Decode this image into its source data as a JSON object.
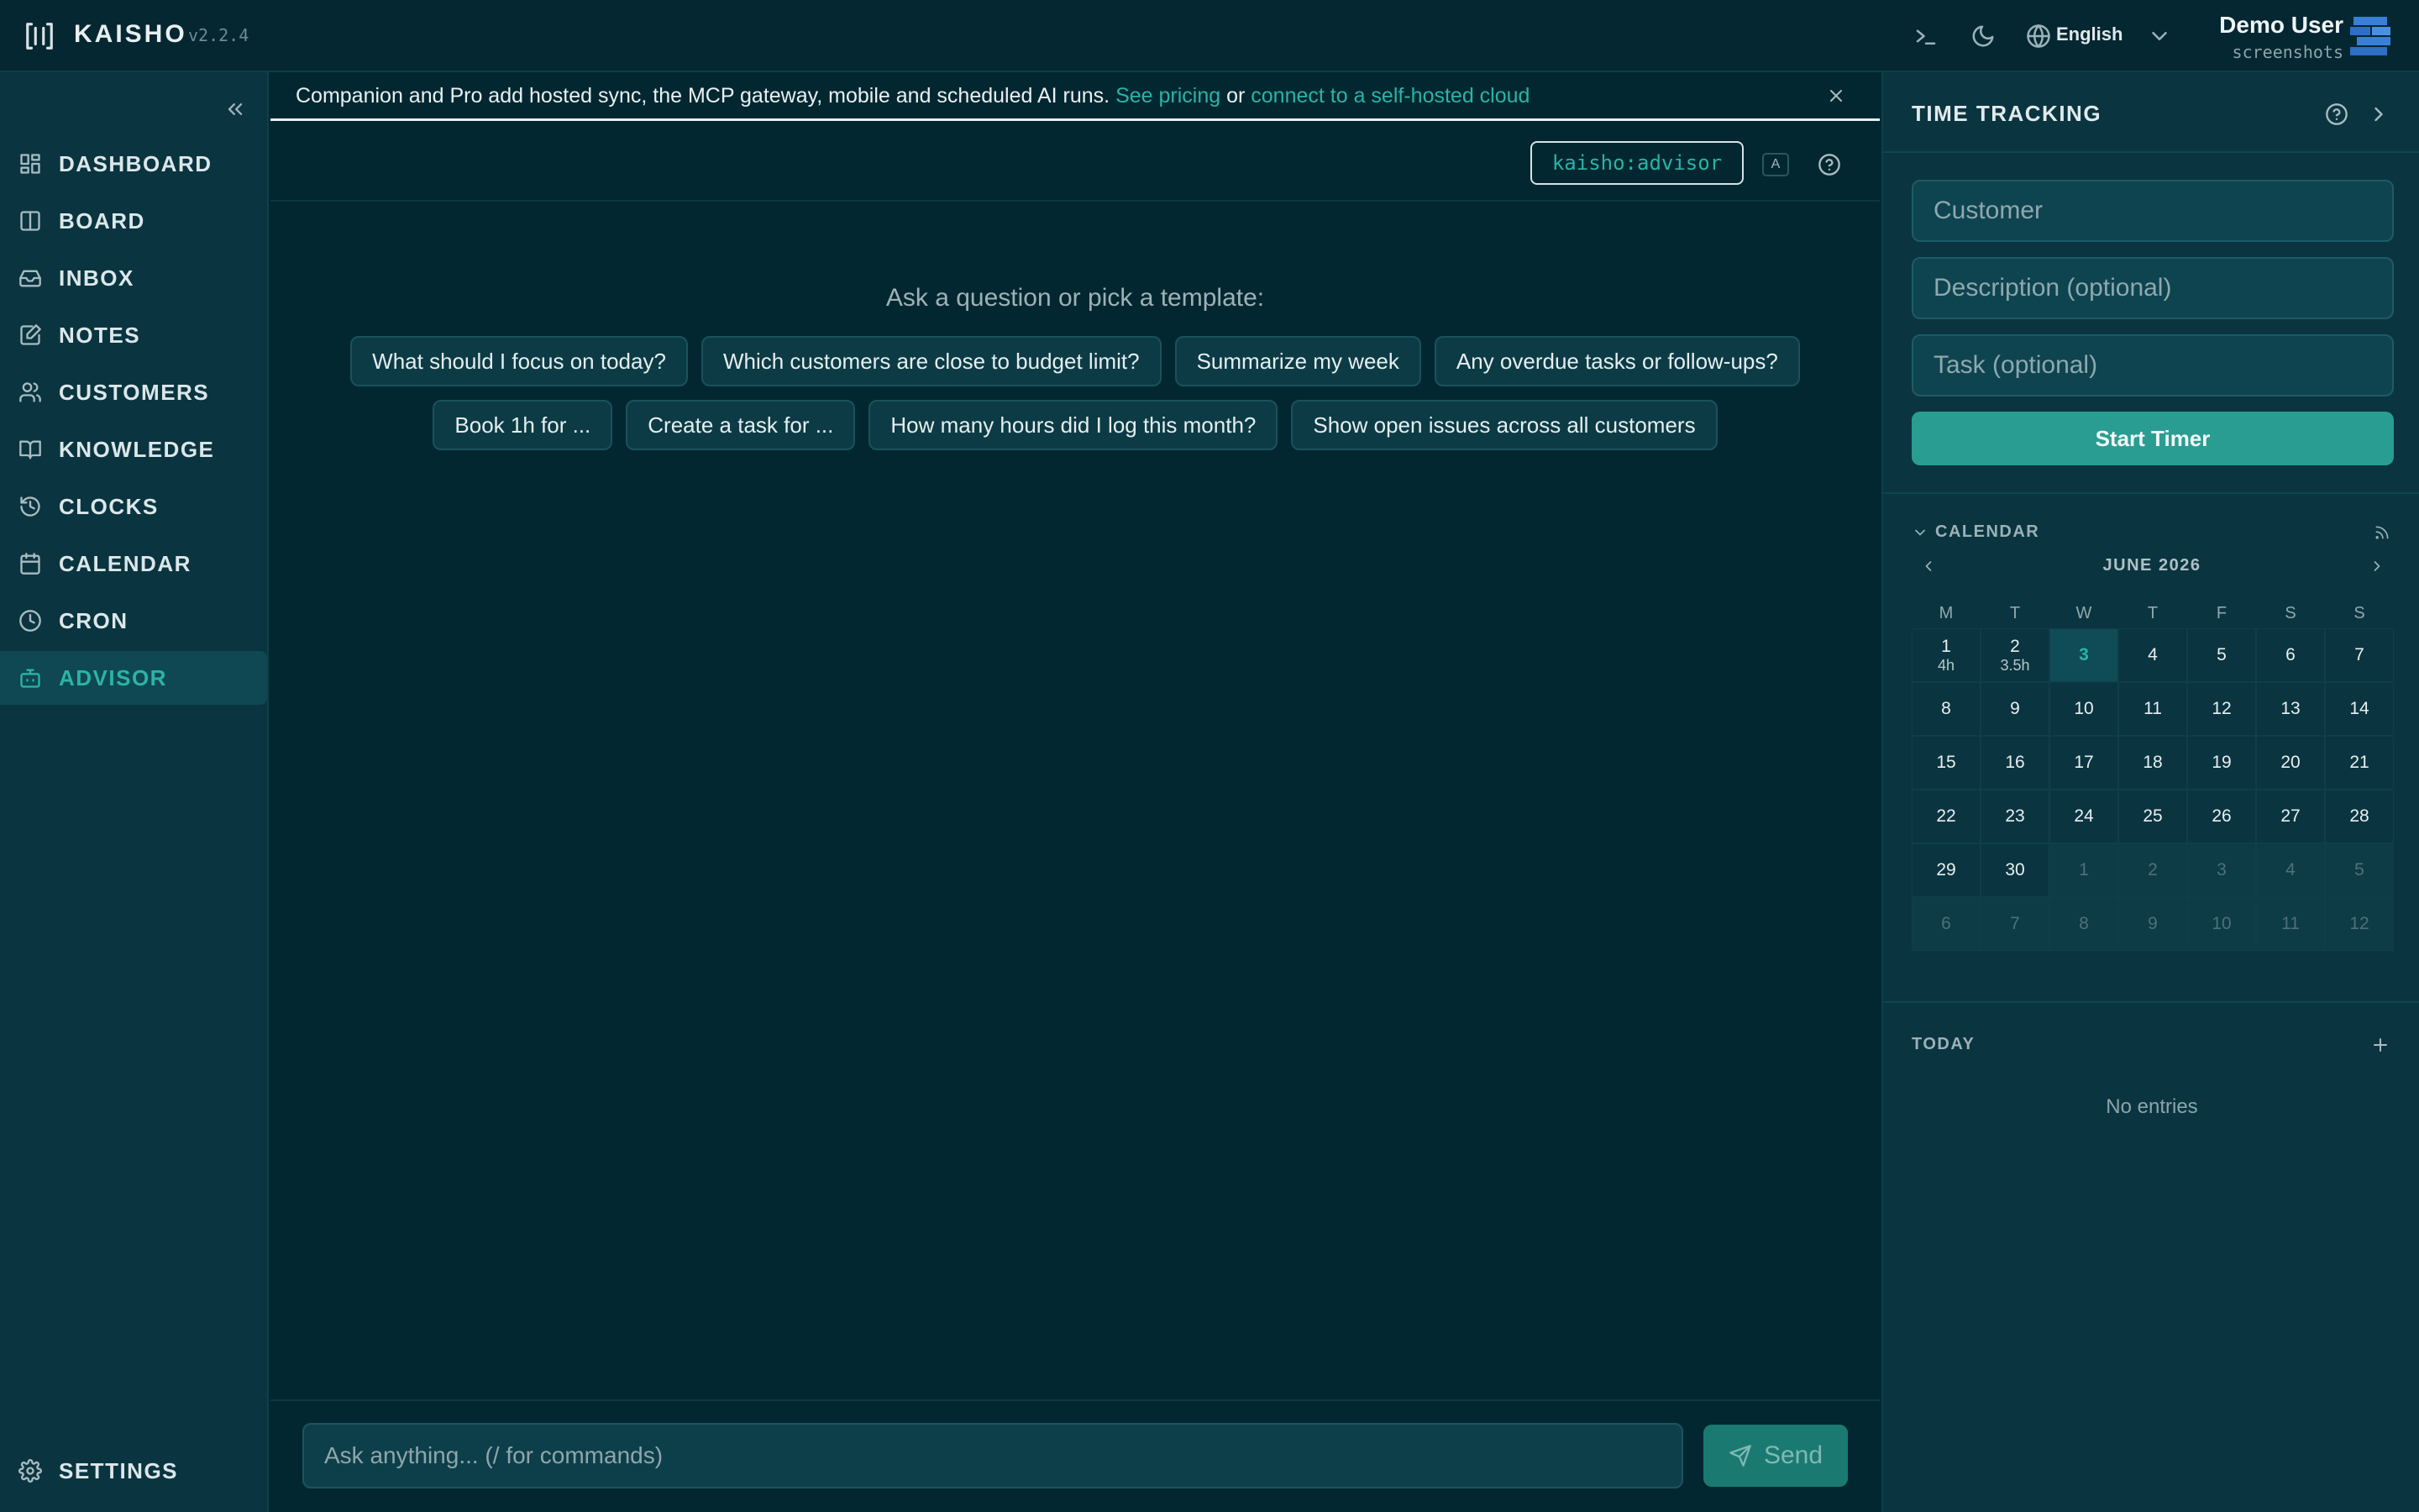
{
  "app": {
    "name": "KAISHO",
    "version": "v2.2.4"
  },
  "topbar": {
    "language": "English",
    "user_name": "Demo User",
    "user_company": "screenshots"
  },
  "sidebar": {
    "items": [
      {
        "label": "DASHBOARD",
        "icon": "dashboard-icon",
        "active": false
      },
      {
        "label": "BOARD",
        "icon": "board-icon",
        "active": false
      },
      {
        "label": "INBOX",
        "icon": "inbox-icon",
        "active": false
      },
      {
        "label": "NOTES",
        "icon": "notes-icon",
        "active": false
      },
      {
        "label": "CUSTOMERS",
        "icon": "customers-icon",
        "active": false
      },
      {
        "label": "KNOWLEDGE",
        "icon": "book-icon",
        "active": false
      },
      {
        "label": "CLOCKS",
        "icon": "history-icon",
        "active": false
      },
      {
        "label": "CALENDAR",
        "icon": "calendar-icon",
        "active": false
      },
      {
        "label": "CRON",
        "icon": "clock-icon",
        "active": false
      },
      {
        "label": "ADVISOR",
        "icon": "bot-icon",
        "active": true
      }
    ],
    "settings_label": "SETTINGS"
  },
  "banner": {
    "text": "Companion and Pro add hosted sync, the MCP gateway, mobile and scheduled AI runs.",
    "link_pricing": "See pricing",
    "or": "or",
    "link_cloud": "connect to a self-hosted cloud"
  },
  "advisor": {
    "agent_tag": "kaisho:advisor",
    "agent_key": "A",
    "prompt_title": "Ask a question or pick a template:",
    "templates_row1": [
      "What should I focus on today?",
      "Which customers are close to budget limit?",
      "Summarize my week",
      "Any overdue tasks or follow-ups?"
    ],
    "templates_row2": [
      "Book 1h for ...",
      "Create a task for ...",
      "How many hours did I log this month?",
      "Show open issues across all customers"
    ],
    "input_placeholder": "Ask anything... (/ for commands)",
    "send_label": "Send"
  },
  "time_tracking": {
    "title": "TIME TRACKING",
    "customer_placeholder": "Customer",
    "description_placeholder": "Description (optional)",
    "task_placeholder": "Task (optional)",
    "start_label": "Start Timer"
  },
  "calendar": {
    "section_label": "CALENDAR",
    "month_label": "JUNE 2026",
    "weekdays": [
      "M",
      "T",
      "W",
      "T",
      "F",
      "S",
      "S"
    ],
    "days": [
      {
        "d": "1",
        "h": "4h"
      },
      {
        "d": "2",
        "h": "3.5h"
      },
      {
        "d": "3",
        "today": true
      },
      {
        "d": "4"
      },
      {
        "d": "5"
      },
      {
        "d": "6"
      },
      {
        "d": "7"
      },
      {
        "d": "8"
      },
      {
        "d": "9"
      },
      {
        "d": "10"
      },
      {
        "d": "11"
      },
      {
        "d": "12"
      },
      {
        "d": "13"
      },
      {
        "d": "14"
      },
      {
        "d": "15"
      },
      {
        "d": "16"
      },
      {
        "d": "17"
      },
      {
        "d": "18"
      },
      {
        "d": "19"
      },
      {
        "d": "20"
      },
      {
        "d": "21"
      },
      {
        "d": "22"
      },
      {
        "d": "23"
      },
      {
        "d": "24"
      },
      {
        "d": "25"
      },
      {
        "d": "26"
      },
      {
        "d": "27"
      },
      {
        "d": "28"
      },
      {
        "d": "29"
      },
      {
        "d": "30"
      },
      {
        "d": "1",
        "other": true
      },
      {
        "d": "2",
        "other": true
      },
      {
        "d": "3",
        "other": true
      },
      {
        "d": "4",
        "other": true
      },
      {
        "d": "5",
        "other": true
      },
      {
        "d": "6",
        "other": true
      },
      {
        "d": "7",
        "other": true
      },
      {
        "d": "8",
        "other": true
      },
      {
        "d": "9",
        "other": true
      },
      {
        "d": "10",
        "other": true
      },
      {
        "d": "11",
        "other": true
      },
      {
        "d": "12",
        "other": true
      }
    ]
  },
  "today": {
    "section_label": "TODAY",
    "empty_text": "No entries"
  },
  "colors": {
    "accent": "#2bb3a6",
    "background": "#032731",
    "sidebar": "#0a3540"
  }
}
